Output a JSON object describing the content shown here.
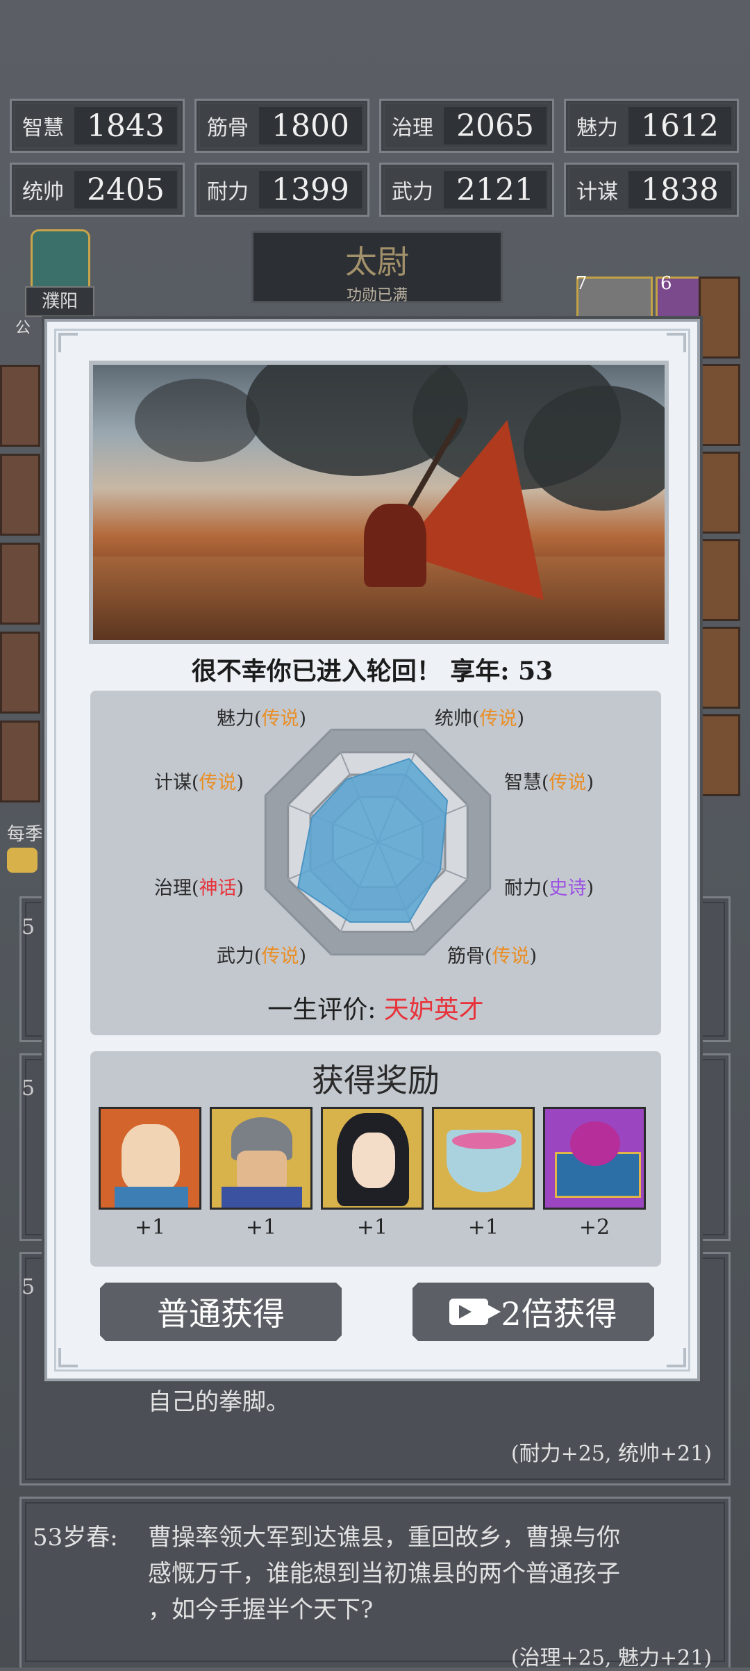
{
  "stats": [
    {
      "label": "智慧",
      "value": "1843"
    },
    {
      "label": "筋骨",
      "value": "1800"
    },
    {
      "label": "治理",
      "value": "2065"
    },
    {
      "label": "魅力",
      "value": "1612"
    },
    {
      "label": "统帅",
      "value": "2405"
    },
    {
      "label": "耐力",
      "value": "1399"
    },
    {
      "label": "武力",
      "value": "2121"
    },
    {
      "label": "计谋",
      "value": "1838"
    }
  ],
  "rank": {
    "title": "太尉",
    "subtitle": "功勋已满"
  },
  "location": {
    "name": "濮阳"
  },
  "side_badges": {
    "left_top": "公",
    "left_bottom": "每季",
    "right_num1": "7",
    "right_num2": "6"
  },
  "behind_card_prefix": "5",
  "modal": {
    "headline": "很不幸你已进入轮回！ 享年: 53",
    "radar": {
      "labels": [
        {
          "name": "魅力",
          "grade": "传说",
          "color": "orange"
        },
        {
          "name": "统帅",
          "grade": "传说",
          "color": "orange"
        },
        {
          "name": "计谋",
          "grade": "传说",
          "color": "orange"
        },
        {
          "name": "智慧",
          "grade": "传说",
          "color": "orange"
        },
        {
          "name": "治理",
          "grade": "神话",
          "color": "red"
        },
        {
          "name": "耐力",
          "grade": "史诗",
          "color": "purple"
        },
        {
          "name": "武力",
          "grade": "传说",
          "color": "orange"
        },
        {
          "name": "筋骨",
          "grade": "传说",
          "color": "orange"
        }
      ]
    },
    "evaluation": {
      "label": "一生评价:",
      "value": "天妒英才"
    },
    "rewards": {
      "title": "获得奖励",
      "items": [
        {
          "icon": "hero-portrait-1",
          "count": "+1",
          "bg": "#d2642c"
        },
        {
          "icon": "hero-portrait-2",
          "count": "+1",
          "bg": "#d8b24a"
        },
        {
          "icon": "hero-portrait-3",
          "count": "+1",
          "bg": "#d8b24a"
        },
        {
          "icon": "teacup",
          "count": "+1",
          "bg": "#d8b24a"
        },
        {
          "icon": "treasure-chest",
          "count": "+2",
          "bg": "#9b46c0"
        }
      ]
    },
    "buttons": {
      "normal": "普通获得",
      "double": "2倍获得"
    }
  },
  "log": {
    "line_a": "自己的拳脚。",
    "stat_a": "(耐力+25, 统帅+21)",
    "entry_age": "53岁春:",
    "entry_text_1": "曹操率领大军到达谯县，重回故乡，曹操与你",
    "entry_text_2": "感慨万千，谁能想到当初谯县的两个普通孩子",
    "entry_text_3": "，如今手握半个天下?",
    "stat_b": "(治理+25, 魅力+21)"
  }
}
